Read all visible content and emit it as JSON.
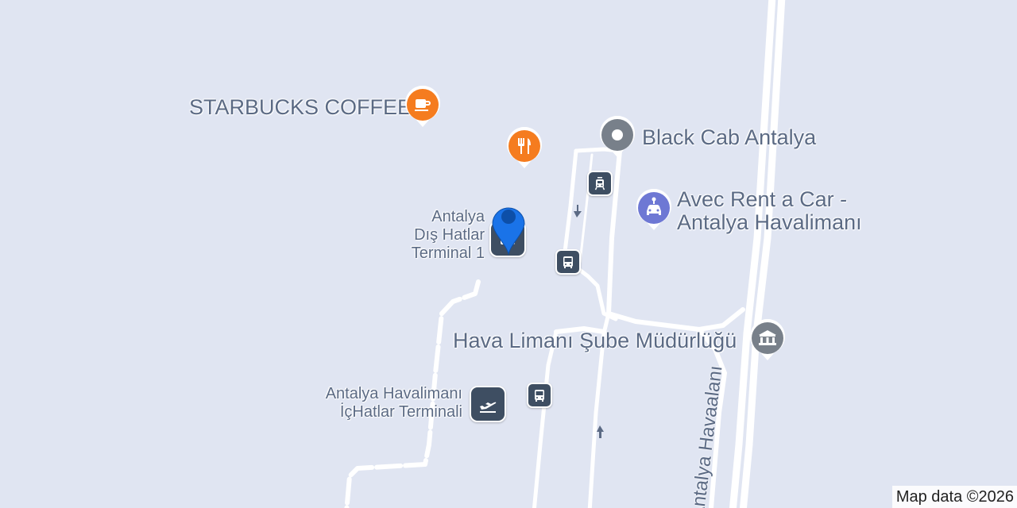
{
  "map": {
    "background": "#e0e5f2",
    "road_color": "#ffffff",
    "label_color": "#5b6a84",
    "attribution": "Map data ©2026"
  },
  "places": [
    {
      "id": "starbucks",
      "name": "STARBUCKS COFFEE",
      "icon": "coffee-cup-icon",
      "color": "#f57c1f"
    },
    {
      "id": "restaurant",
      "name": "",
      "icon": "fork-knife-icon",
      "color": "#f57c1f"
    },
    {
      "id": "black-cab",
      "name": "Black Cab Antalya",
      "icon": "place-dot-icon",
      "color": "#78808a"
    },
    {
      "id": "avec",
      "name_line1": "Avec Rent a Car -",
      "name_line2": "Antalya Havalimanı",
      "icon": "car-rental-icon",
      "color": "#6e78d4"
    },
    {
      "id": "terminal1",
      "name_line1": "Antalya",
      "name_line2": "Dış Hatlar",
      "name_line3": "Terminal 1",
      "icon": "terminal-icon",
      "color": "#3e4e62"
    },
    {
      "id": "sube",
      "name": "Hava Limanı Şube Müdürlüğü",
      "icon": "government-building-icon",
      "color": "#78808a"
    },
    {
      "id": "ichatlar",
      "name_line1": "Antalya Havalimanı",
      "name_line2": "İçHatlar Terminali",
      "icon": "airplane-departure-icon",
      "color": "#3e4e62"
    }
  ],
  "transit": [
    {
      "id": "tram-stop",
      "icon": "tram-icon"
    },
    {
      "id": "bus-stop-1",
      "icon": "bus-icon"
    },
    {
      "id": "bus-stop-2",
      "icon": "bus-icon"
    }
  ],
  "roads": [
    {
      "id": "antalya-havaalani",
      "name": "Antalya Havaalanı"
    }
  ],
  "selected_marker": {
    "color": "#1a73e8",
    "inner_color": "#0d4fa8"
  }
}
